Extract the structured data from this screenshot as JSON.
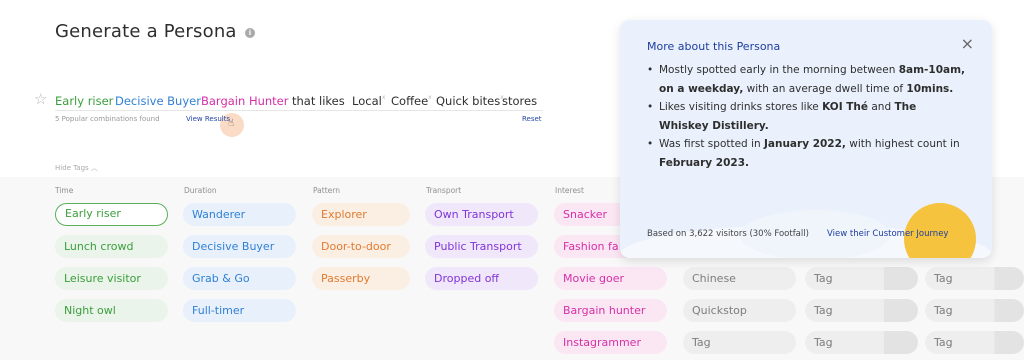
{
  "page": {
    "title": "Generate a Persona",
    "info_icon": "i"
  },
  "builder": {
    "chips": [
      "Early riser",
      "Decisive Buyer",
      "Bargain Hunter"
    ],
    "connector": "that likes",
    "likes": [
      "Local",
      "Coffee",
      "Quick bites"
    ],
    "like_superscripts": [
      "x",
      "x",
      "x"
    ],
    "suffix": "stores",
    "combinations_text": "5 Popular combinations found",
    "view_results_label": "View Results",
    "reset_label": "Reset",
    "hide_tags_label": "Hide Tags"
  },
  "columns": [
    {
      "header": "Time",
      "tags": [
        "Early riser",
        "Lunch crowd",
        "Leisure visitor",
        "Night owl"
      ]
    },
    {
      "header": "Duration",
      "tags": [
        "Wanderer",
        "Decisive Buyer",
        "Grab & Go",
        "Full-timer"
      ]
    },
    {
      "header": "Pattern",
      "tags": [
        "Explorer",
        "Door-to-door",
        "Passerby"
      ]
    },
    {
      "header": "Transport",
      "tags": [
        "Own Transport",
        "Public Transport",
        "Dropped off"
      ]
    },
    {
      "header": "Interest",
      "tags": [
        "Snacker",
        "Fashion fa",
        "Movie goer",
        "Bargain hunter",
        "Instagrammer"
      ]
    },
    {
      "header": "",
      "tags": [
        "Chinese",
        "Quickstop",
        "Tag"
      ]
    },
    {
      "header": "",
      "tags": [
        "Tag",
        "Tag",
        "Tag"
      ]
    },
    {
      "header": "",
      "tags": [
        "Tag",
        "Tag",
        "Tag"
      ]
    }
  ],
  "popup": {
    "title": "More about this Persona",
    "bullet1": {
      "t1": "Mostly spotted early in the morning between ",
      "b1": "8am-10am, on a weekday,",
      "t2": " with an average dwell time of ",
      "b2": "10mins."
    },
    "bullet2": {
      "t1": "Likes visiting drinks stores like ",
      "b1": "KOI Thé",
      "t2": " and ",
      "b2": "The Whiskey Distillery."
    },
    "bullet3": {
      "t1": "Was first spotted in ",
      "b1": "January 2022,",
      "t2": " with highest count in ",
      "b2": "February 2023."
    },
    "footnote": "Based on 3,622 visitors (30% Footfall)",
    "journey_link": "View their Customer Journey",
    "close_icon": "×"
  },
  "colors": {
    "green": "#3b9e3c",
    "blue": "#2f7fd6",
    "pink": "#d62fa7",
    "orange": "#e07a2f",
    "purple": "#7f35d8",
    "popup_bg": "#eaf1fc",
    "sun": "#f5c33e"
  }
}
